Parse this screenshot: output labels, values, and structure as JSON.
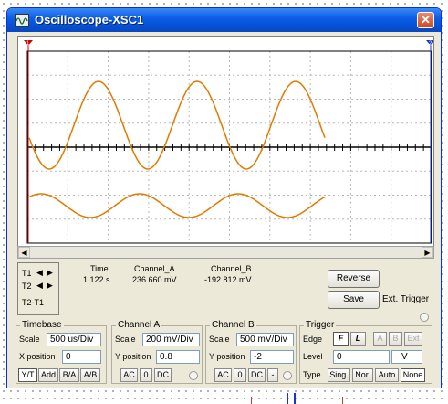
{
  "window": {
    "title": "Oscilloscope-XSC1",
    "close_glyph": "✕"
  },
  "screen": {
    "background": "#ffffff",
    "grid_color": "#b8b8b8",
    "axis_color": "#000000",
    "trace_color": "#e07b00",
    "cursor1_color": "#cc0000",
    "cursor2_color": "#1a33cc",
    "cursor1_label": "1",
    "cursor2_label": "2"
  },
  "readout": {
    "t1": "T1",
    "t2": "T2",
    "t2_t1": "T2-T1",
    "headers": {
      "time": "Time",
      "channel_a": "Channel_A",
      "channel_b": "Channel_B"
    },
    "row": {
      "time": "1.122 s",
      "channel_a": "236.660 mV",
      "channel_b": "-192.812 mV"
    },
    "reverse_label": "Reverse",
    "save_label": "Save",
    "ext_trigger_label": "Ext. Trigger"
  },
  "timebase": {
    "title": "Timebase",
    "scale_label": "Scale",
    "scale_value": "500 us/Div",
    "xpos_label": "X position",
    "xpos_value": "0",
    "buttons": [
      "Y/T",
      "Add",
      "B/A",
      "A/B"
    ]
  },
  "channel_a": {
    "title": "Channel A",
    "scale_label": "Scale",
    "scale_value": "200 mV/Div",
    "ypos_label": "Y position",
    "ypos_value": "0.8",
    "coupling": [
      "AC",
      "0",
      "DC"
    ]
  },
  "channel_b": {
    "title": "Channel B",
    "scale_label": "Scale",
    "scale_value": "500 mV/Div",
    "ypos_label": "Y position",
    "ypos_value": "-2",
    "coupling": [
      "AC",
      "0",
      "DC",
      "-"
    ]
  },
  "trigger": {
    "title": "Trigger",
    "edge_label": "Edge",
    "edge_buttons": [
      "F",
      "L",
      "A",
      "B",
      "Ext"
    ],
    "level_label": "Level",
    "level_value": "0",
    "level_unit": "V",
    "type_label": "Type",
    "type_buttons": [
      "Sing.",
      "Nor.",
      "Auto",
      "None"
    ]
  }
}
